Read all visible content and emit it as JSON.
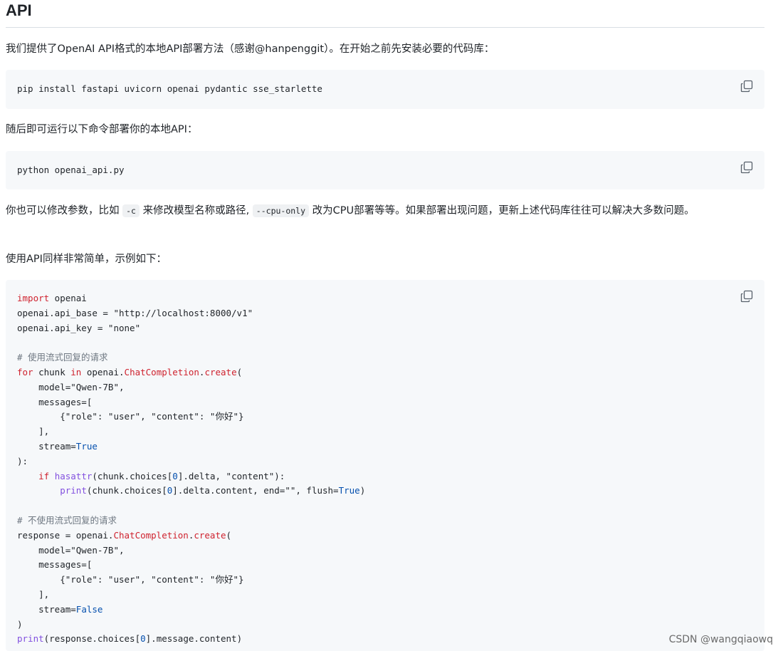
{
  "heading": "API",
  "intro": "我们提供了OpenAI API格式的本地API部署方法（感谢@hanpenggit）。在开始之前先安装必要的代码库：",
  "install_cmd": "pip install fastapi uvicorn openai pydantic sse_starlette",
  "run_text": "随后即可运行以下命令部署你的本地API：",
  "run_cmd": "python openai_api.py",
  "modify": {
    "part1": "你也可以修改参数，比如",
    "code1": "-c",
    "part2": "来修改模型名称或路径,",
    "code2": "--cpu-only",
    "part3": "改为CPU部署等等。如果部署出现问题，更新上述代码库往往可以解决大多数问题。"
  },
  "usage_text": "使用API同样非常简单，示例如下：",
  "code": {
    "l1_kw": "import",
    "l1_rest": " openai",
    "l2": "openai.api_base = \"http://localhost:8000/v1\"",
    "l3": "openai.api_key = \"none\"",
    "c1": "# 使用流式回复的请求",
    "for_kw": "for",
    "chunk": " chunk ",
    "in_kw": "in",
    "openai_dot": " openai.",
    "chatcompletion": "ChatCompletion",
    "dot": ".",
    "create": "create",
    "paren_open": "(",
    "model_line": "    model=\"Qwen-7B\",",
    "messages_line": "    messages=[",
    "msg_dict": "        {\"role\": \"user\", \"content\": \"你好\"}",
    "close_bracket": "    ],",
    "stream_prefix": "    stream=",
    "true_val": "True",
    "close_paren_colon": "):",
    "if_indent": "    ",
    "if_kw": "if",
    "hasattr": "hasattr",
    "hasattr_args": "(chunk.choices[",
    "zero": "0",
    "hasattr_end": "].delta, \"content\"):",
    "print_indent": "        ",
    "print_kw": "print",
    "print_args": "(chunk.choices[",
    "print_end": "].delta.content, end=\"\", flush=",
    "true_val2": "True",
    "close": ")",
    "c2": "# 不使用流式回复的请求",
    "response_prefix": "response = openai.",
    "false_val": "False",
    "close_final": ")",
    "print_final_args": "(response.choices[",
    "print_final_end": "].message.content)"
  },
  "watermark": "CSDN @wangqiaowq",
  "icons": {
    "copy": "copy-icon"
  }
}
